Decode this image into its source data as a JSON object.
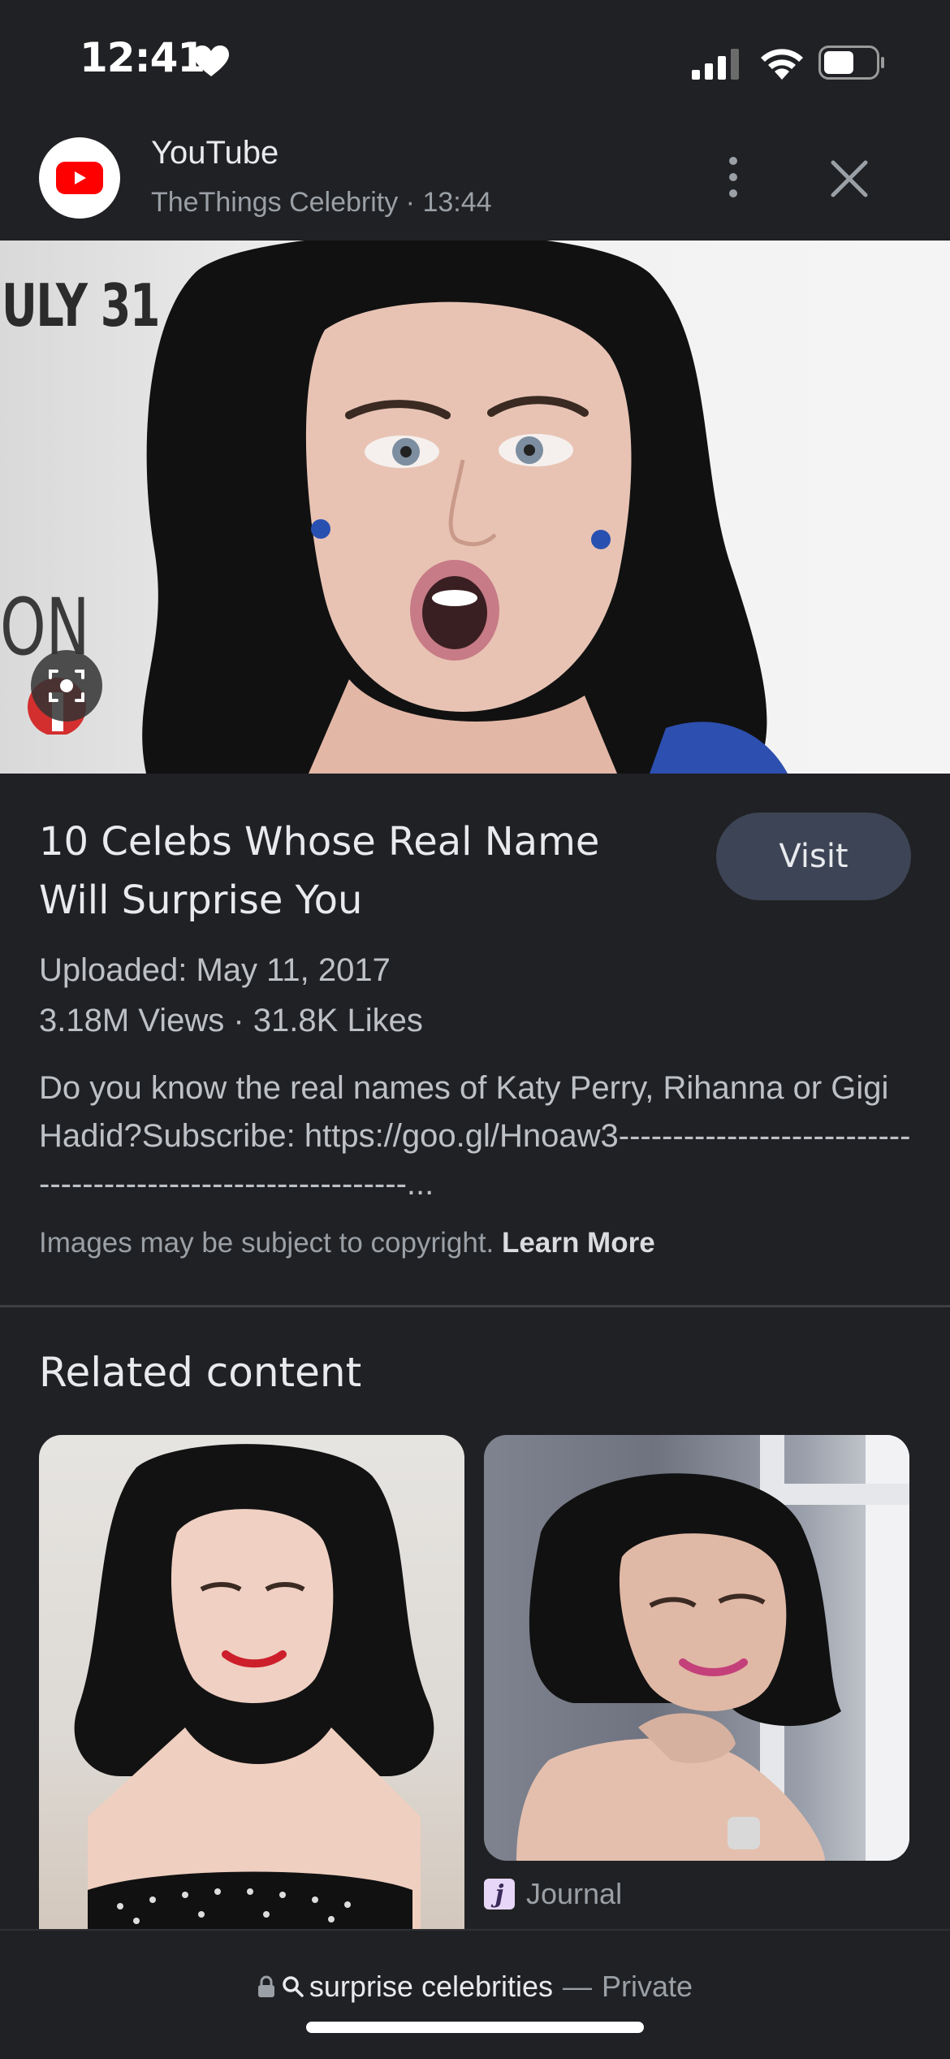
{
  "status_bar": {
    "time": "12:41",
    "icons": [
      "heart-icon",
      "signal-icon",
      "wifi-icon",
      "battery-icon"
    ]
  },
  "header": {
    "app_name": "YouTube",
    "subtitle": "TheThings Celebrity · 13:44",
    "icons": [
      "youtube-logo-icon",
      "more-vert-icon",
      "close-icon"
    ]
  },
  "hero": {
    "sign_text_top": "ULY 31",
    "sign_text_mid": "ON",
    "badge_icon": "lens-icon"
  },
  "result": {
    "title": "10 Celebs Whose Real Name Will Surprise You",
    "visit_label": "Visit",
    "uploaded": "Uploaded: May 11, 2017",
    "stats": "3.18M Views · 31.8K Likes",
    "description": "Do you know the real names of Katy Perry, Rihanna or Gigi Hadid?Subscribe: https://goo.gl/Hnoaw3-------------------------------------------------------------...",
    "copyright_text": "Images may be subject to copyright.",
    "learn_more": "Learn More"
  },
  "related": {
    "heading": "Related content",
    "cards": [
      {
        "source": ""
      },
      {
        "source": "Journal",
        "source_icon": "j"
      }
    ]
  },
  "bottom_bar": {
    "query": "surprise celebrities",
    "separator": "—",
    "mode": "Private"
  },
  "colors": {
    "background": "#202124",
    "visit_button": "#3c4455",
    "youtube_red": "#ff0000"
  }
}
